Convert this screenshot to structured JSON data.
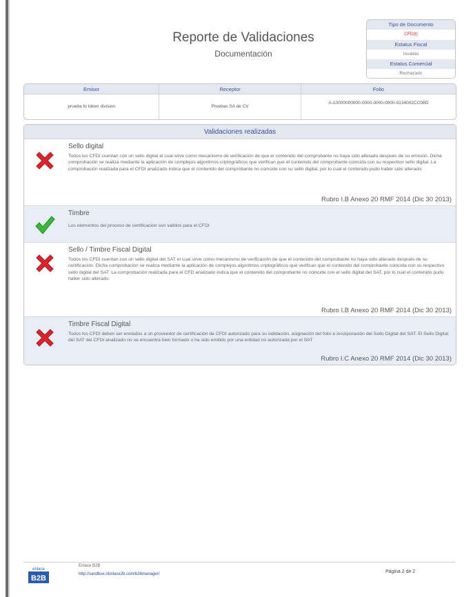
{
  "header": {
    "title": "Reporte de Validaciones",
    "subtitle": "Documentación"
  },
  "doc_status": {
    "tipo_label": "Tipo de Documento",
    "tipo_value": "CFD(I)",
    "fiscal_label": "Estatus Fiscal",
    "fiscal_value": "Inválido",
    "comercial_label": "Estatus Comercial",
    "comercial_value": "Rechazado",
    "accent_color": "#e02020"
  },
  "info_table": {
    "emisor_label": "Emisor",
    "emisor_value": "prueba fo token division",
    "receptor_label": "Receptor",
    "receptor_value": "Pruebas SA de CV",
    "folio_label": "Folio",
    "folio_value": "A-10000000000-0000-0000-0000-0134002CC08D"
  },
  "validations": {
    "section_title": "Validaciones realizadas",
    "items": [
      {
        "status": "error",
        "icon": "red-x-icon",
        "title": "Sello digital",
        "description": "Todos los CFDI cuentan con un sello digital el cual sirve como mecanismo de verificación de que el contenido del comprobante no haya sido alterado después de su emisión. Dicha comprobación se realiza mediante la aplicación de complejos algoritmos criptográficos que verifican que el contenido del comprobante coincida con su respectivo sello digital. La comprobación realizada para el CFDI analizado indica que el contenido del comprobante no coincide con su sello digital, por lo cual el contenido pudo haber sido alterado.",
        "reference": "Rubro I.B Anexo 20 RMF 2014 (Dic 30 2013)"
      },
      {
        "status": "ok",
        "icon": "green-check-icon",
        "title": "Timbre",
        "description": "Los elementos del proceso de certificacion son validos para el CFDI",
        "reference": ""
      },
      {
        "status": "error",
        "icon": "red-x-icon",
        "title": "Sello / Timbre Fiscal Digital",
        "description": "Todos los CFDI cuentan con un sello digital del SAT el cual sirve como mecanismo de verificación de que el contenido del comprobante no haya sido alterado después de su certificación. Dicha comprobación se realiza mediante la aplicación de complejos algoritmos criptográficos que verifican que el contenido del comprobante coincida con su respectivo sello digital del SAT. La comprobación realizada para el CFD analizado indica que el contenido del comprobante no coincide con el sello digital del SAT, por lo cual el contenido pudo haber sido alterado.",
        "reference": "Rubro I.B Anexo 20 RMF 2014 (Dic 30 2013)"
      },
      {
        "status": "error",
        "icon": "red-x-icon",
        "title": "Timbre Fiscal Digital",
        "description": "Todos los CFDI deben ser enviados a un proveedor de certificación de CFDI autorizado para su validación, asignación del folio e incorporación del Sello Digital del SAT. El Sello Digital del SAT del CFDI analizado no se encuentra bien formado o ha sido emitido por una entidad no autorizada por el SAT",
        "reference": "Rubro I.C Anexo 20 RMF 2014 (Dic 30 2013)"
      }
    ]
  },
  "footer": {
    "logo_top": "enlace",
    "logo_bottom": "B2B",
    "company": "Enlace B2B",
    "url": "http://sandbox.ntorlace2b.com/b2bmanager/",
    "page": "Página 2 de 2"
  }
}
